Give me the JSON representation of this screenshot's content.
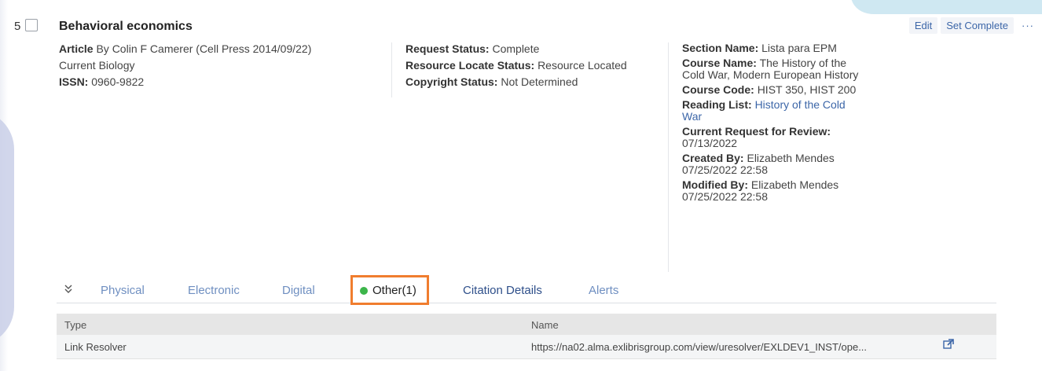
{
  "record": {
    "number": "5",
    "title": "Behavioral economics",
    "type_label": "Article",
    "byline": "By Colin F Camerer (Cell Press 2014/09/22)",
    "journal": "Current Biology",
    "issn_label": "ISSN:",
    "issn_value": "0960-9822"
  },
  "status": {
    "request_label": "Request Status:",
    "request_value": "Complete",
    "locate_label": "Resource Locate Status:",
    "locate_value": "Resource Located",
    "copyright_label": "Copyright Status:",
    "copyright_value": "Not Determined"
  },
  "details": {
    "section_label": "Section Name:",
    "section_value": "Lista para EPM",
    "course_name_label": "Course Name:",
    "course_name_value": "The History of the Cold War, Modern European History",
    "course_code_label": "Course Code:",
    "course_code_value": "HIST 350, HIST 200",
    "reading_list_label": "Reading List:",
    "reading_list_value": "History of the Cold War",
    "review_label": "Current Request for Review:",
    "review_value": "07/13/2022",
    "created_label": "Created By:",
    "created_value": "Elizabeth Mendes 07/25/2022 22:58",
    "modified_label": "Modified By:",
    "modified_value": "Elizabeth Mendes 07/25/2022 22:58"
  },
  "actions": {
    "edit": "Edit",
    "set_complete": "Set Complete",
    "more": "···"
  },
  "tabs": {
    "collapse_icon": "»",
    "physical": "Physical",
    "electronic": "Electronic",
    "digital": "Digital",
    "other": "Other(1)",
    "citation": "Citation Details",
    "alerts": "Alerts"
  },
  "table": {
    "col_type": "Type",
    "col_name": "Name",
    "rows": [
      {
        "type": "Link Resolver",
        "name": "https://na02.alma.exlibrisgroup.com/view/uresolver/EXLDEV1_INST/ope..."
      }
    ]
  },
  "colors": {
    "accent": "#3c66a8",
    "highlight": "#f07d2e",
    "status_dot": "#3cb54a"
  }
}
